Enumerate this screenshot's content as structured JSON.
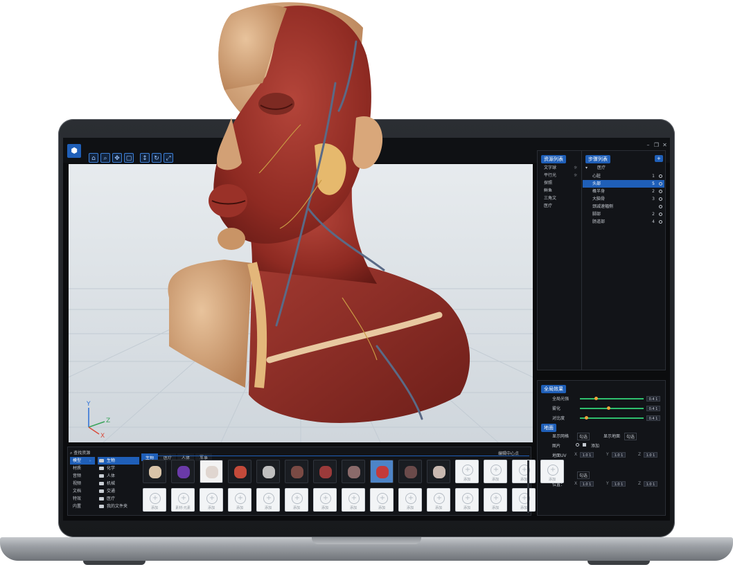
{
  "app": {
    "toolbar_icons": [
      "home-icon",
      "zoom-icon",
      "pan-icon",
      "frame-icon",
      "move-icon",
      "rotate-icon",
      "scale-icon"
    ],
    "window_controls": [
      "minimize-icon",
      "restore-icon",
      "close-icon"
    ]
  },
  "resource_list": {
    "title": "资源列表",
    "items": [
      "文字球",
      "平行光",
      "探照",
      "鲜鱼",
      "三角文",
      "医疗"
    ]
  },
  "step_list": {
    "title": "步骤列表",
    "add_label": "+",
    "root": "医疗",
    "steps": [
      {
        "label": "心脏",
        "count": "1"
      },
      {
        "label": "头部",
        "count": "5"
      },
      {
        "label": "概半身",
        "count": "2"
      },
      {
        "label": "大脑骨",
        "count": "3"
      },
      {
        "label": "颈减速幅侧",
        "count": ""
      },
      {
        "label": "脚部",
        "count": "2"
      },
      {
        "label": "肠道部",
        "count": "4"
      }
    ]
  },
  "global_effects": {
    "title": "全局效果",
    "sliders": [
      {
        "label": "全局光强",
        "value": "0.4 1",
        "level": 0.25
      },
      {
        "label": "雾化",
        "value": "0.4 1",
        "level": 0.45
      },
      {
        "label": "对比度",
        "value": "0.4 1",
        "level": 0.1
      }
    ]
  },
  "ground": {
    "title": "地面",
    "show_grid_label": "显示网格",
    "show_grid_value": "勾选",
    "show_ground_label": "显示地面",
    "show_ground_value": "勾选",
    "image_label": "图片",
    "image_add": "添加",
    "uv_label": "地面UV",
    "uv_axes": [
      "X",
      "Y",
      "Z"
    ],
    "uv_values": [
      "1.0 1",
      "1.0 1",
      "1.0 1"
    ]
  },
  "character": {
    "title": "人物",
    "show_label": "显示",
    "show_value": "勾选",
    "pos_label": "位置：",
    "pos_axes": [
      "X",
      "Y",
      "Z"
    ],
    "pos_values": [
      "1.0 1",
      "1.0 1",
      "1.0 1"
    ]
  },
  "viewport": {
    "axis_y": "Y",
    "axis_z": "Z",
    "axis_x": "X"
  },
  "asset_browser": {
    "search_placeholder": "查找资源",
    "center_button": "编辑中心点",
    "categories": [
      "模型",
      "材质",
      "音频",
      "视频",
      "文档",
      "特效",
      "内置"
    ],
    "folders": [
      "生物",
      "化学",
      "人体",
      "机械",
      "交通",
      "医疗",
      "我的文件夹"
    ],
    "tabs": [
      "生物",
      "医疗",
      "人体",
      "军事"
    ],
    "add_label": "添加",
    "selected_label": "素材-元素",
    "asset_names": [
      "jaw-model",
      "ear-model",
      "lungs-model",
      "virus-model",
      "virus-model-2",
      "spine-model",
      "torso-model",
      "organ-model",
      "heart-model",
      "brain-model",
      "skull-model"
    ]
  },
  "colors": {
    "accent": "#1f5fb8",
    "slider": "#2fbf6e",
    "thumb": "#f0a33a",
    "muscle": "#8e2a22",
    "skin": "#d9a77a"
  }
}
